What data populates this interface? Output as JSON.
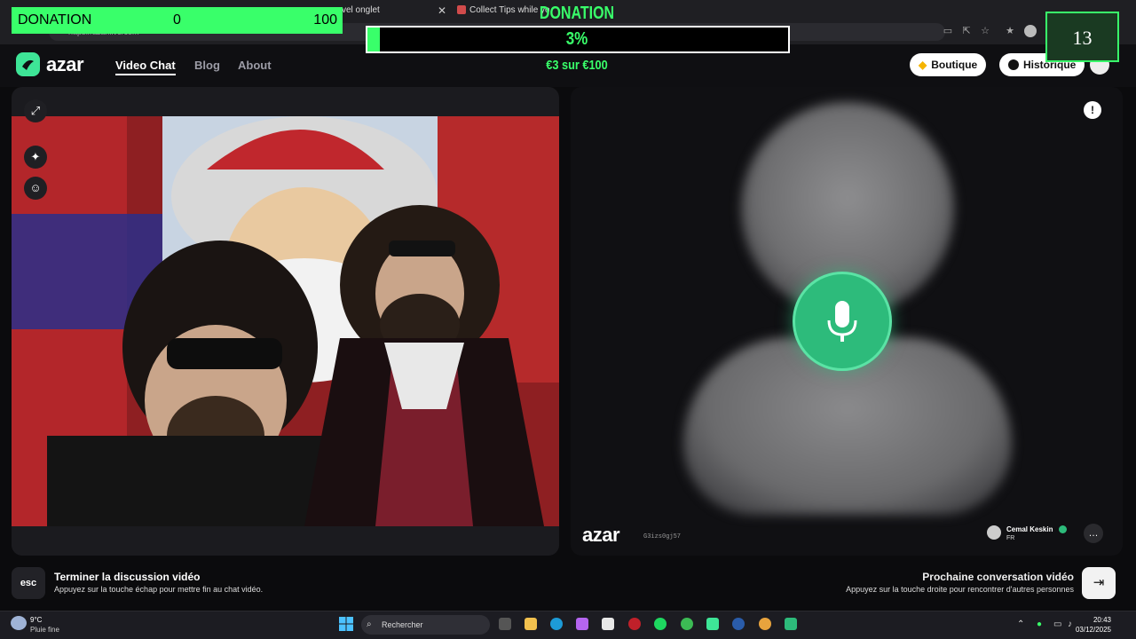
{
  "browser": {
    "tab2_title": "vel onglet",
    "tab3_title": "Collect Tips while you're",
    "address": "https://azar.live/com"
  },
  "site": {
    "logo": "azar",
    "nav": [
      "Video Chat",
      "Blog",
      "About"
    ],
    "shop_label": "Boutique",
    "history_label": "Historique"
  },
  "right_panel": {
    "watermark": "azar",
    "session_id": "G3izs0gj57",
    "partner_name": "Cemal Keskin",
    "partner_country": "FR"
  },
  "footer": {
    "esc_key": "esc",
    "end_title": "Terminer la discussion vidéo",
    "end_sub": "Appuyez sur la touche échap pour mettre fin au chat vidéo.",
    "next_title": "Prochaine conversation vidéo",
    "next_sub": "Appuyez sur la touche droite pour rencontrer d'autres personnes"
  },
  "overlay": {
    "donation_label": "DONATION",
    "donation_current": "0",
    "donation_max": "100",
    "goal_title": "DONATION",
    "goal_percent_text": "3%",
    "goal_percent": 3,
    "goal_amount": "€3 sur €100",
    "counter": "13",
    "accent_color": "#39ff6a"
  },
  "taskbar": {
    "weather_temp": "9°C",
    "weather_desc": "Pluie fine",
    "search_placeholder": "Rechercher",
    "time": "20:43",
    "date": "03/12/2025"
  },
  "colors": {
    "brand_green": "#3ee597",
    "mic_green": "#2dbb7b"
  }
}
